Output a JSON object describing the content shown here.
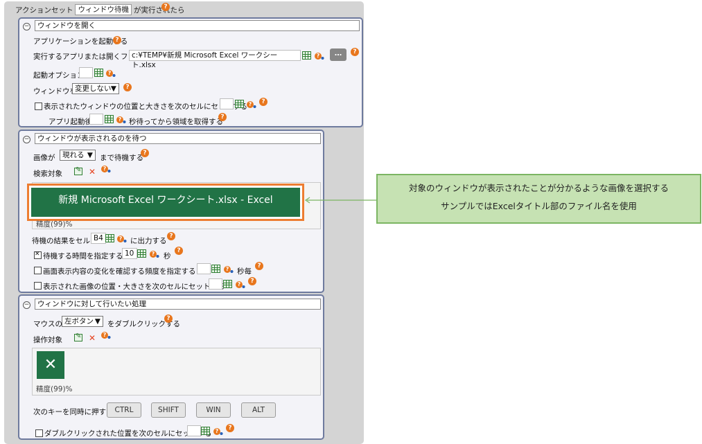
{
  "header": {
    "prefix": "アクションセット",
    "action_name": "ウィンドウ待機",
    "suffix": "が実行されたら"
  },
  "section1": {
    "title": "ウィンドウを開く",
    "launch_app_label": "アプリケーションを起動する",
    "file_label": "実行するアプリまたは開くファイル",
    "file_value": "c:¥TEMP¥新規 Microsoft Excel ワークシート.xlsx",
    "browse_label": "…",
    "launch_option_label": "起動オプション",
    "window_label": "ウィンドウを",
    "window_select": "変更しない",
    "set_pos_label": "表示されたウィンドウの位置と大きさを次のセルにセットする",
    "after_launch_label": "アプリ起動後",
    "wait_seconds_label": "秒待ってから領域を取得する"
  },
  "section2": {
    "title": "ウィンドウが表示されるのを待つ",
    "image_label": "画像が",
    "appear_select": "現れる",
    "wait_until_label": "まで待機する",
    "search_target_label": "検索対象",
    "preview_text": "新規 Microsoft Excel ワークシート.xlsx  -  Excel",
    "accuracy": "精度(99)%",
    "result_cell_label": "待機の結果をセル",
    "result_cell_value": "B4",
    "result_cell_suffix": "に出力する",
    "timeout_label": "待機する時間を指定する",
    "timeout_value": "10",
    "timeout_unit": "秒",
    "frequency_label": "画面表示内容の変化を確認する頻度を指定する",
    "frequency_unit": "秒毎",
    "set_image_pos_label": "表示された画像の位置・大きさを次のセルにセットする"
  },
  "section3": {
    "title": "ウィンドウに対して行いたい処理",
    "mouse_label": "マウスの",
    "button_select": "左ボタン",
    "double_click_label": "をダブルクリックする",
    "operation_target_label": "操作対象",
    "excel_icon_glyph": "✕",
    "accuracy": "精度(99)%",
    "keys_label": "次のキーを同時に押す",
    "keys": [
      "CTRL",
      "SHIFT",
      "WIN",
      "ALT"
    ],
    "set_click_pos_label": "ダブルクリックされた位置を次のセルにセットする"
  },
  "callout": {
    "line1": "対象のウィンドウが表示されたことが分かるような画像を選択する",
    "line2": "サンプルではExcelタイトル部のファイル名を使用"
  },
  "icons": {
    "help": "?",
    "collapse": "−",
    "dropdown": "▼",
    "delete": "✕"
  },
  "colors": {
    "excel_green": "#217346",
    "highlight_orange": "#ed7d31",
    "help_orange": "#e8761d",
    "callout_bg": "#c6e2b3",
    "callout_border": "#7bb562",
    "card_border": "#6e7a9e"
  }
}
